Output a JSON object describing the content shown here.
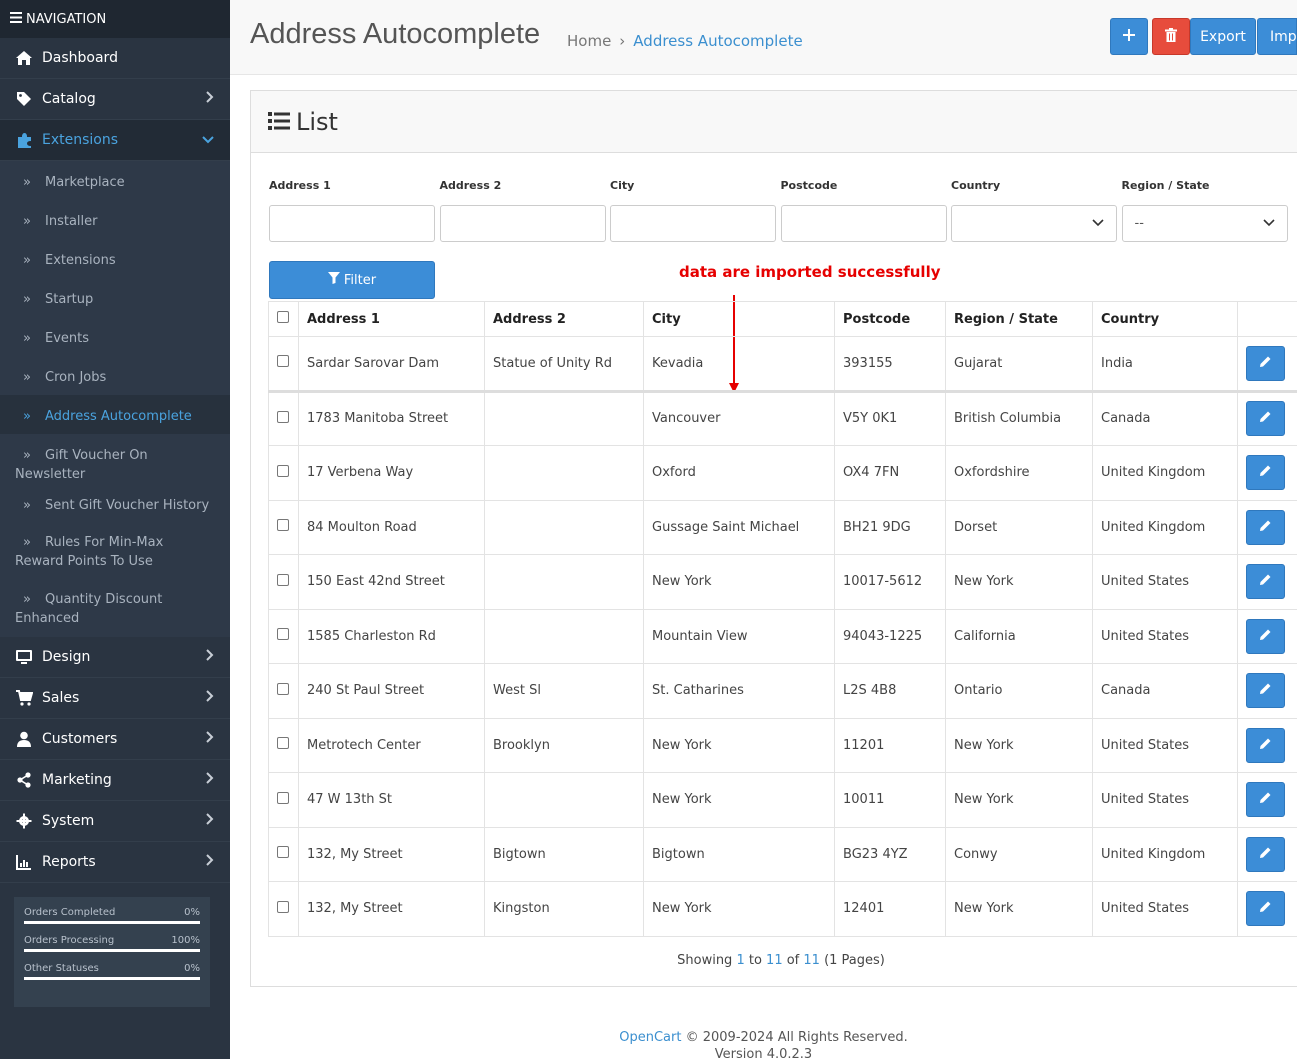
{
  "sidebar": {
    "header": "NAVIGATION",
    "menu": [
      {
        "label": "Dashboard",
        "icon": "home-icon",
        "chevron": false
      },
      {
        "label": "Catalog",
        "icon": "tag-icon",
        "chevron": true
      },
      {
        "label": "Extensions",
        "icon": "puzzle-icon",
        "chevron": true,
        "active": true
      }
    ],
    "submenu": [
      {
        "label": "Marketplace"
      },
      {
        "label": "Installer"
      },
      {
        "label": "Extensions"
      },
      {
        "label": "Startup"
      },
      {
        "label": "Events"
      },
      {
        "label": "Cron Jobs"
      },
      {
        "label": "Address Autocomplete",
        "active": true
      },
      {
        "label": "Gift Voucher On Newsletter"
      },
      {
        "label": "Sent Gift Voucher History"
      },
      {
        "label": "Rules For Min-Max Reward Points To Use"
      },
      {
        "label": "Quantity Discount Enhanced"
      }
    ],
    "menu2": [
      {
        "label": "Design",
        "icon": "desktop-icon"
      },
      {
        "label": "Sales",
        "icon": "cart-icon"
      },
      {
        "label": "Customers",
        "icon": "user-icon"
      },
      {
        "label": "Marketing",
        "icon": "share-icon"
      },
      {
        "label": "System",
        "icon": "gear-icon"
      },
      {
        "label": "Reports",
        "icon": "chart-icon"
      }
    ],
    "stats": [
      {
        "label": "Orders Completed",
        "value": "0%"
      },
      {
        "label": "Orders Processing",
        "value": "100%"
      },
      {
        "label": "Other Statuses",
        "value": "0%"
      }
    ]
  },
  "header": {
    "title": "Address Autocomplete",
    "breadcrumb": {
      "home": "Home",
      "separator": "›",
      "current": "Address Autocomplete"
    },
    "export_label": "Export",
    "import_label": "Impo"
  },
  "card": {
    "title": "List",
    "filters": [
      {
        "label": "Address 1",
        "value": ""
      },
      {
        "label": "Address 2",
        "value": ""
      },
      {
        "label": "City",
        "value": ""
      },
      {
        "label": "Postcode",
        "value": ""
      },
      {
        "label": "Country",
        "value": "",
        "select": true
      },
      {
        "label": "Region / State",
        "value": "--",
        "select": true
      }
    ],
    "filter_button": "Filter",
    "annotation": "data are imported successfully",
    "columns": [
      "Address 1",
      "Address 2",
      "City",
      "Postcode",
      "Region / State",
      "Country"
    ],
    "rows": [
      [
        "Sardar Sarovar Dam",
        "Statue of Unity Rd",
        "Kevadia",
        "393155",
        "Gujarat",
        "India"
      ],
      [
        "1783 Manitoba Street",
        "",
        "Vancouver",
        "V5Y 0K1",
        "British Columbia",
        "Canada"
      ],
      [
        "17 Verbena Way",
        "",
        "Oxford",
        "OX4 7FN",
        "Oxfordshire",
        "United Kingdom"
      ],
      [
        "84 Moulton Road",
        "",
        "Gussage Saint Michael",
        "BH21 9DG",
        "Dorset",
        "United Kingdom"
      ],
      [
        "150 East 42nd Street",
        "",
        "New York",
        "10017-5612",
        "New York",
        "United States"
      ],
      [
        "1585 Charleston Rd",
        "",
        "Mountain View",
        "94043-1225",
        "California",
        "United States"
      ],
      [
        "240 St Paul Street",
        "West Sl",
        "St. Catharines",
        "L2S 4B8",
        "Ontario",
        "Canada"
      ],
      [
        "Metrotech Center",
        "Brooklyn",
        "New York",
        "11201",
        "New York",
        "United States"
      ],
      [
        "47 W 13th St",
        "",
        "New York",
        "10011",
        "New York",
        "United States"
      ],
      [
        "132, My Street",
        "Bigtown",
        "Bigtown",
        "BG23 4YZ",
        "Conwy",
        "United Kingdom"
      ],
      [
        "132, My Street",
        "Kingston",
        "New York",
        "12401",
        "New York",
        "United States"
      ]
    ],
    "pagination": {
      "prefix": "Showing ",
      "from": "1",
      "to_word": " to ",
      "to": "11",
      "of_word": " of ",
      "total": "11",
      "pages": " (1 Pages)"
    }
  },
  "footer": {
    "brand": "OpenCart",
    "copyright": " © 2009-2024 All Rights Reserved.",
    "version": "Version 4.0.2.3"
  },
  "colors": {
    "accent": "#3c8dd7",
    "danger": "#e74c3c",
    "sidebar": "#2a3441",
    "annotation": "#e60000"
  }
}
